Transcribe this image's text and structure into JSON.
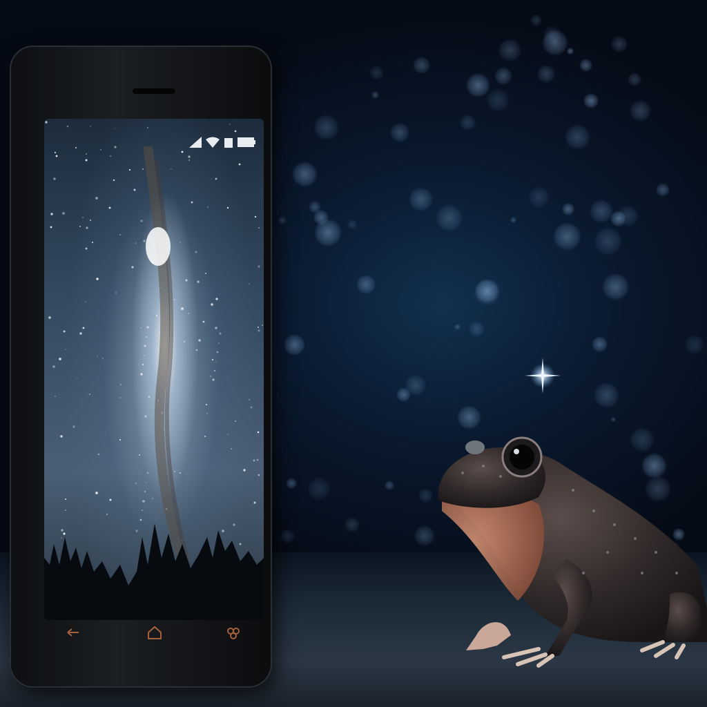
{
  "scene": {
    "subject": "frog",
    "device": "smartphone",
    "background": "night-sky-bokeh"
  },
  "phone": {
    "status_icons": [
      "signal-icon",
      "wifi-icon",
      "battery-icon"
    ],
    "nav_icons": [
      "back-icon",
      "home-icon",
      "menu-icon"
    ],
    "screen_content": "milky-way-photo"
  },
  "colors": {
    "sky": "#0a1a30",
    "bokeh": "#96bee6",
    "glow": "#e6aa6e",
    "frog_skin": "#3a3232",
    "frog_belly": "#c8826a"
  }
}
